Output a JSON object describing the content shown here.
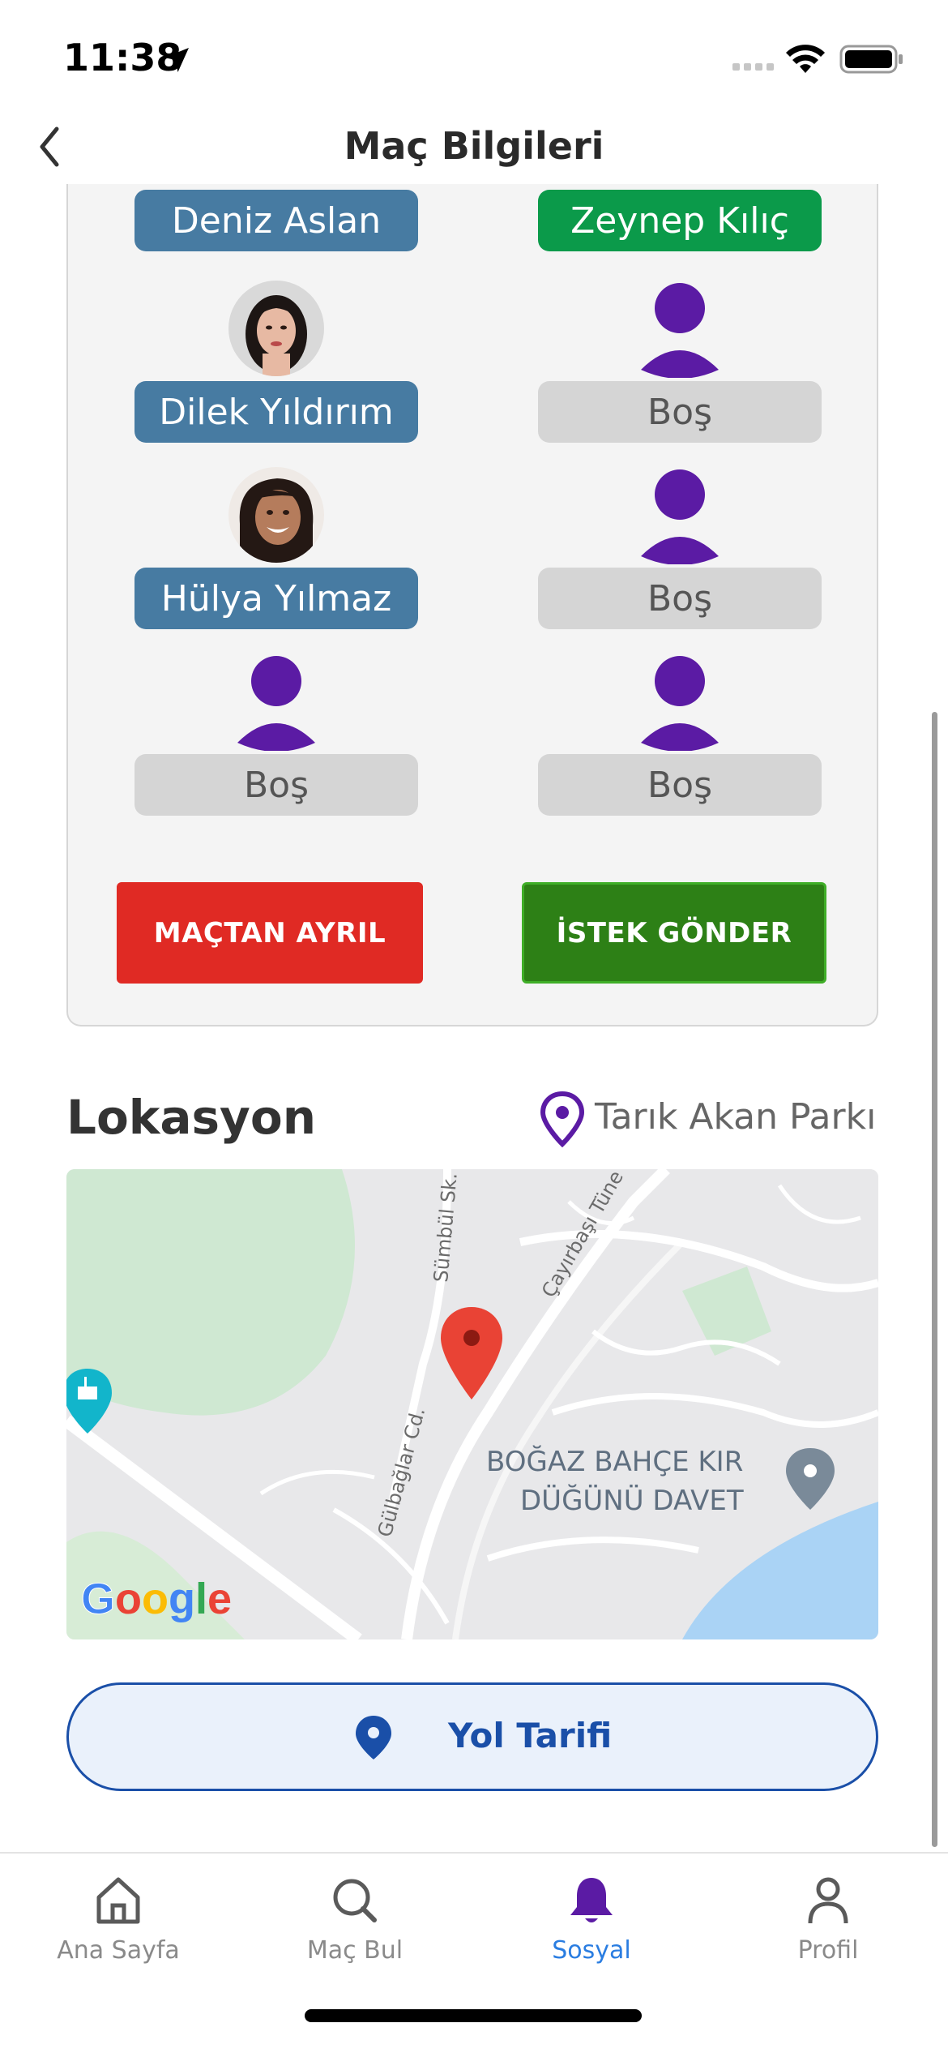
{
  "status_bar": {
    "time": "11:38"
  },
  "header": {
    "title": "Maç Bilgileri"
  },
  "team_left": [
    {
      "name": "Deniz Aslan",
      "state": "filled"
    },
    {
      "name": "Dilek Yıldırım",
      "state": "filled"
    },
    {
      "name": "Hülya Yılmaz",
      "state": "filled"
    },
    {
      "name": "Boş",
      "state": "empty"
    }
  ],
  "team_right": [
    {
      "name": "Zeynep Kılıç",
      "state": "highlighted"
    },
    {
      "name": "Boş",
      "state": "empty"
    },
    {
      "name": "Boş",
      "state": "empty"
    },
    {
      "name": "Boş",
      "state": "empty"
    }
  ],
  "actions": {
    "leave_label": "MAÇTAN AYRIL",
    "request_label": "İSTEK GÖNDER"
  },
  "location": {
    "title": "Lokasyon",
    "place": "Tarık Akan Parkı",
    "directions_label": "Yol Tarifi"
  },
  "map": {
    "street_1": "Sümbül Sk.",
    "street_2": "Çayırbaşı Tüne",
    "street_3": "Gülbağlar Cd.",
    "poi_line_1": "BOĞAZ BAHÇE KIR",
    "poi_line_2": "DÜĞÜNÜ DAVET",
    "logo": "Google"
  },
  "tabs": [
    {
      "label": "Ana Sayfa",
      "icon": "home-icon",
      "active": false
    },
    {
      "label": "Maç Bul",
      "icon": "search-icon",
      "active": false
    },
    {
      "label": "Sosyal",
      "icon": "bell-icon",
      "active": true
    },
    {
      "label": "Profil",
      "icon": "person-icon",
      "active": false
    }
  ],
  "colors": {
    "accent_purple": "#5b1ba4",
    "player_blue": "#477ba2",
    "player_green": "#0b9a4a",
    "leave_red": "#e02a24",
    "request_green": "#2d8016",
    "directions_blue": "#1a4fa8",
    "tab_active": "#2a7de1"
  }
}
